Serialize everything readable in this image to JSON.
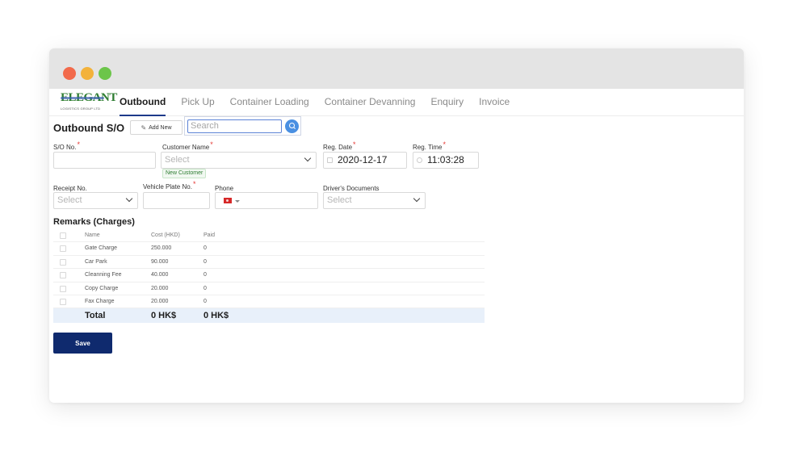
{
  "logo": {
    "text": "ELEGANT",
    "subtitle": "LOGISTICS GROUP LTD"
  },
  "nav": {
    "tabs": [
      "Outbound",
      "Pick Up",
      "Container Loading",
      "Container Devanning",
      "Enquiry",
      "Invoice"
    ],
    "active": "Outbound"
  },
  "header": {
    "title": "Outbound S/O",
    "add_new": "Add New",
    "search_placeholder": "Search"
  },
  "form": {
    "so_no_label": "S/O No.",
    "so_no_value": "",
    "customer_label": "Customer Name",
    "customer_placeholder": "Select",
    "new_customer": "New Customer",
    "reg_date_label": "Reg. Date",
    "reg_date_value": "2020-12-17",
    "reg_time_label": "Reg. Time",
    "reg_time_value": "11:03:28",
    "receipt_label": "Receipt No.",
    "receipt_placeholder": "Select",
    "vehicle_label": "Vehicle Plate No.",
    "vehicle_value": "",
    "phone_label": "Phone",
    "phone_value": "",
    "docs_label": "Driver's Documents",
    "docs_placeholder": "Select",
    "required_mark": "*"
  },
  "remarks": {
    "title": "Remarks (Charges)",
    "headers": {
      "name": "Name",
      "cost": "Cost (HKD)",
      "paid": "Paid"
    },
    "rows": [
      {
        "name": "Gate Charge",
        "cost": "250.000",
        "paid": "0"
      },
      {
        "name": "Car Park",
        "cost": "90.000",
        "paid": "0"
      },
      {
        "name": "Cleanning Fee",
        "cost": "40.000",
        "paid": "0"
      },
      {
        "name": "Copy Charge",
        "cost": "20.000",
        "paid": "0"
      },
      {
        "name": "Fax Charge",
        "cost": "20.000",
        "paid": "0"
      }
    ],
    "total": {
      "label": "Total",
      "cost": "0 HK$",
      "paid": "0 HK$"
    }
  },
  "actions": {
    "save": "Save"
  },
  "colors": {
    "primary": "#0f2a6e",
    "accent": "#4a90e2",
    "required": "#e53935",
    "total_bg": "#e8f0fa"
  }
}
